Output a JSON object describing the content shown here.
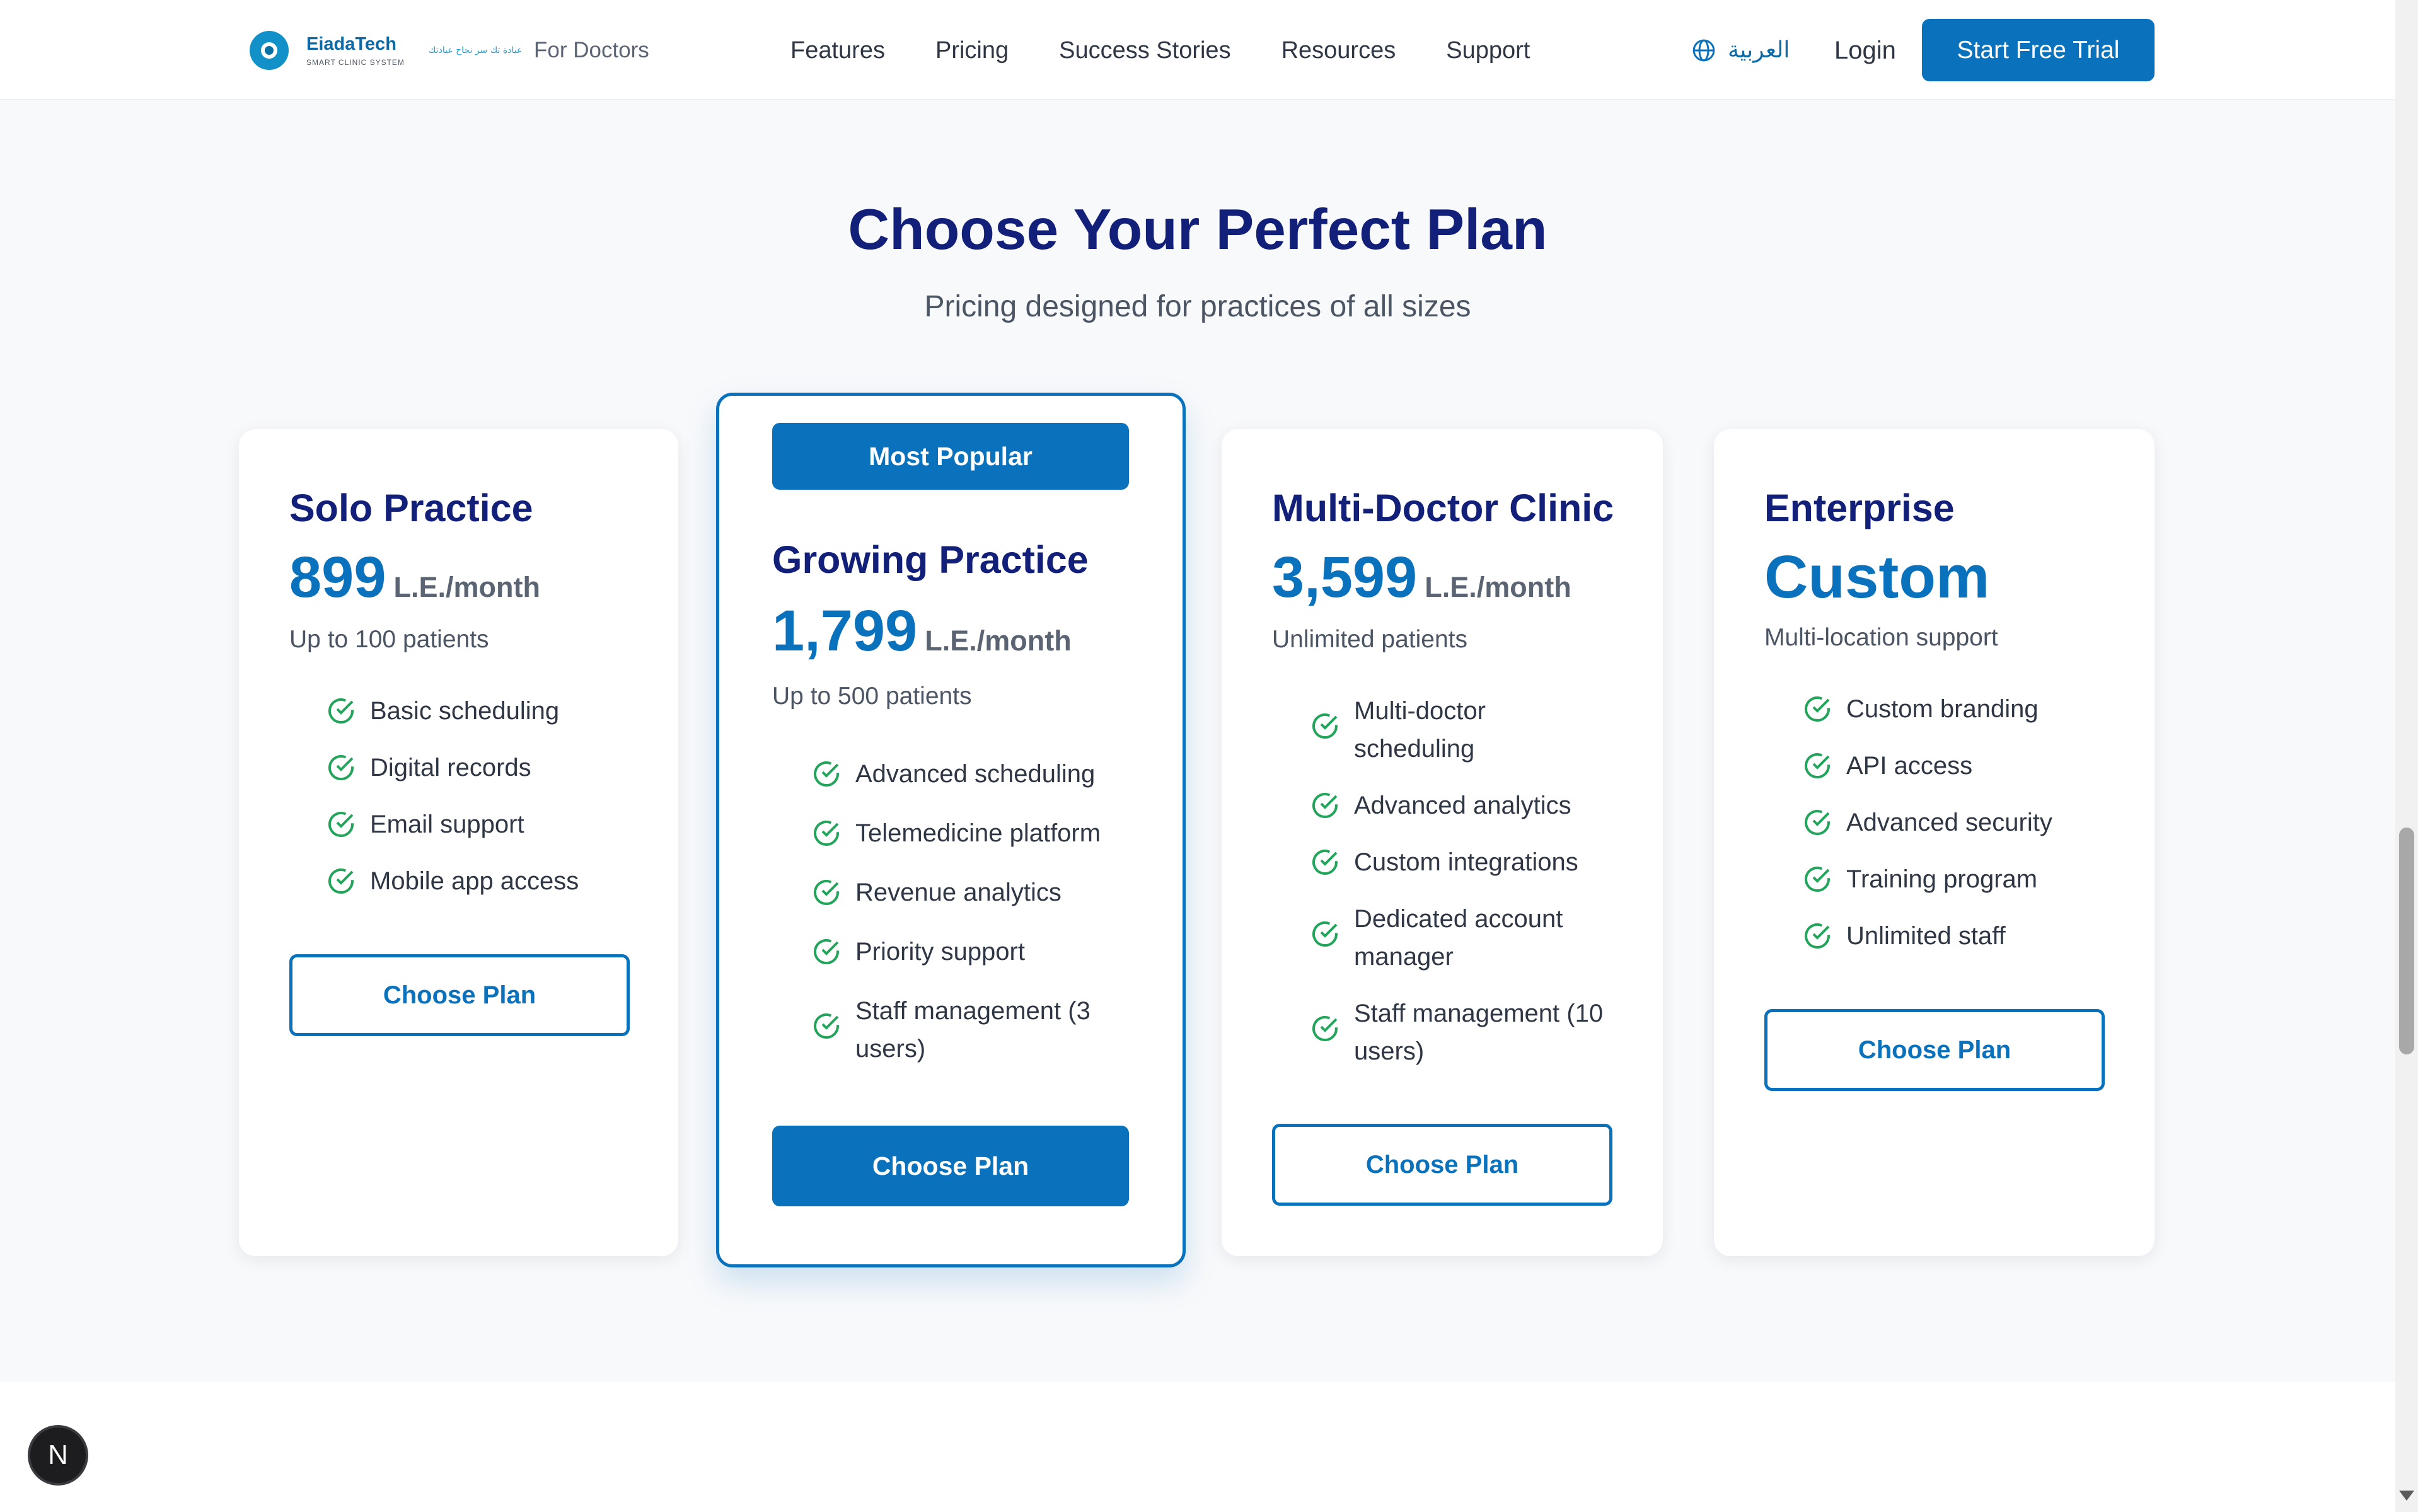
{
  "header": {
    "brand_name": "EiadaTech",
    "brand_tagline": "SMART CLINIC SYSTEM",
    "brand_arabic": "عيادة تك سر نجاح عيادتك",
    "audience_label": "For Doctors",
    "nav": [
      "Features",
      "Pricing",
      "Success Stories",
      "Resources",
      "Support"
    ],
    "language_label": "العربية",
    "login_label": "Login",
    "cta_label": "Start Free Trial"
  },
  "section": {
    "title": "Choose Your Perfect Plan",
    "subtitle": "Pricing designed for practices of all sizes"
  },
  "plans": [
    {
      "name": "Solo Practice",
      "price": "899",
      "unit": "L.E./month",
      "limit": "Up to 100 patients",
      "features": [
        "Basic scheduling",
        "Digital records",
        "Email support",
        "Mobile app access"
      ],
      "button": "Choose Plan"
    },
    {
      "badge": "Most Popular",
      "name": "Growing Practice",
      "price": "1,799",
      "unit": "L.E./month",
      "limit": "Up to 500 patients",
      "features": [
        "Advanced scheduling",
        "Telemedicine platform",
        "Revenue analytics",
        "Priority support",
        "Staff management (3 users)"
      ],
      "button": "Choose Plan"
    },
    {
      "name": "Multi-Doctor Clinic",
      "price": "3,599",
      "unit": "L.E./month",
      "limit": "Unlimited patients",
      "features": [
        "Multi-doctor scheduling",
        "Advanced analytics",
        "Custom integrations",
        "Dedicated account manager",
        "Staff management (10 users)"
      ],
      "button": "Choose Plan"
    },
    {
      "name": "Enterprise",
      "price": "Custom",
      "limit": "Multi-location support",
      "features": [
        "Custom branding",
        "API access",
        "Advanced security",
        "Training program",
        "Unlimited staff"
      ],
      "button": "Choose Plan"
    }
  ],
  "dev_badge": "N",
  "colors": {
    "primary": "#0a72bc",
    "heading": "#13207a",
    "check": "#22a55b",
    "page_bg": "#f8f9fb"
  },
  "icons": {
    "logo": "eiadatech-logo-icon",
    "language": "globe-icon",
    "feature": "check-circle-icon"
  }
}
